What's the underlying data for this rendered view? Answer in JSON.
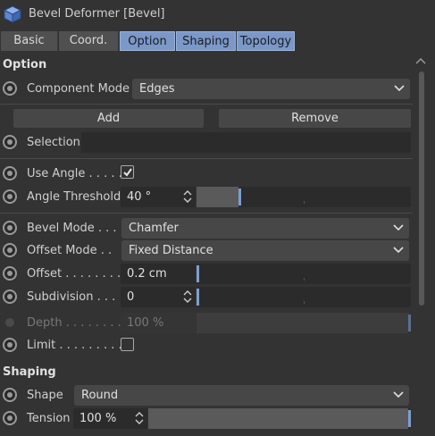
{
  "title": "Bevel Deformer [Bevel]",
  "tabs": [
    "Basic",
    "Coord.",
    "Option",
    "Shaping",
    "Topology"
  ],
  "option_section": {
    "title": "Option",
    "component_mode": {
      "label": "Component Mode",
      "value": "Edges"
    },
    "add_label": "Add",
    "remove_label": "Remove",
    "selection": {
      "label": "Selection",
      "value": ""
    },
    "use_angle": {
      "label": "Use Angle . . . . .",
      "checked": true
    },
    "angle_threshold": {
      "label": "Angle Threshold",
      "value": "40 °",
      "level": 0.2
    },
    "bevel_mode": {
      "label": "Bevel Mode . . .",
      "value": "Chamfer"
    },
    "offset_mode": {
      "label": "Offset Mode . .",
      "value": "Fixed Distance"
    },
    "offset": {
      "label": "Offset . . . . . . . .",
      "value": "0.2 cm",
      "level": 0.0
    },
    "subdivision": {
      "label": "Subdivision . . .",
      "value": "0",
      "level": 0.0
    },
    "depth": {
      "label": "Depth . . . . . . . .",
      "value": "100 %",
      "level": 1.0,
      "disabled": true
    },
    "limit": {
      "label": "Limit . . . . . . . . . .",
      "checked": false
    }
  },
  "shaping_section": {
    "title": "Shaping",
    "shape": {
      "label": "Shape",
      "value": "Round"
    },
    "tension": {
      "label": "Tension",
      "value": "100 %",
      "level": 1.0
    }
  },
  "colors": {
    "background": "#333333",
    "active_tab": "#7b98c9",
    "slider_handle": "#7b9fd6"
  },
  "icons": [
    "bevel-cube-icon",
    "anim-circle-icon",
    "chevron-down-icon",
    "spin-arrows-icon",
    "checkmark-icon",
    "scroll-up-arrow-icon"
  ]
}
